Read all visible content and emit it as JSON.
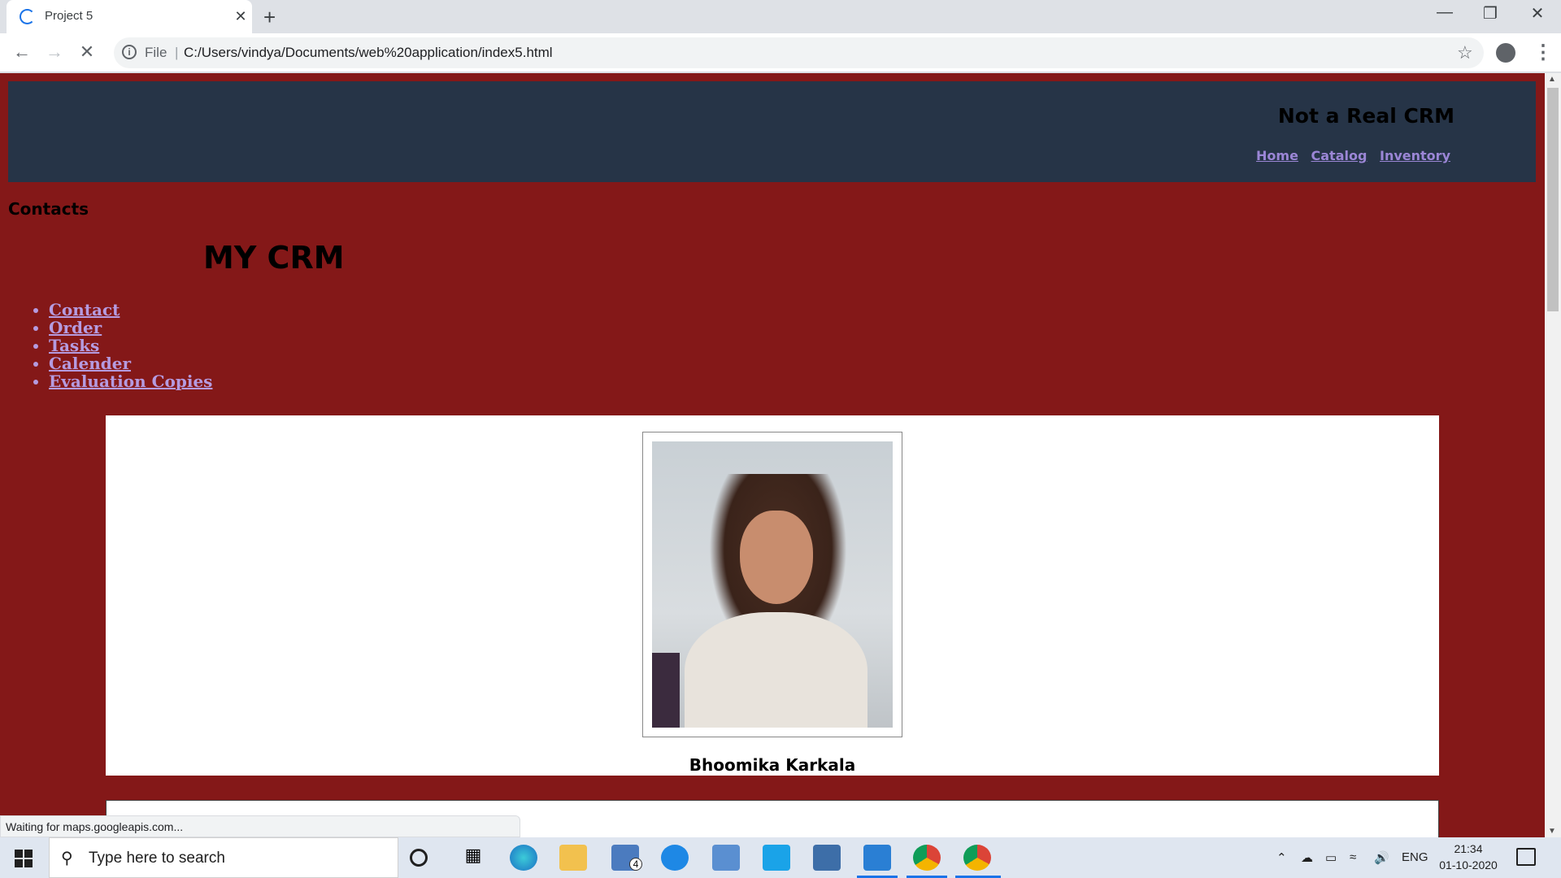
{
  "browser": {
    "tab_title": "Project 5",
    "tab_close": "✕",
    "new_tab": "+",
    "file_label": "File",
    "separator": "|",
    "url": "C:/Users/vindya/Documents/web%20application/index5.html",
    "status_text": "Waiting for maps.googleapis.com..."
  },
  "site": {
    "brand": "Not a Real CRM",
    "top_links": [
      "Home",
      "Catalog",
      "Inventory"
    ],
    "contacts_heading": "Contacts",
    "crm_title": "MY CRM",
    "side_nav": [
      "Contact",
      "Order",
      "Tasks",
      "Calender",
      "Evaluation Copies"
    ],
    "person_name": "Bhoomika Karkala"
  },
  "taskbar": {
    "search_placeholder": "Type here to search",
    "mail_badge": "4",
    "language": "ENG",
    "time": "21:34",
    "date": "01-10-2020"
  },
  "colors": {
    "page_bg": "#841818",
    "header_bg": "#263447",
    "link": "#b59be0"
  }
}
